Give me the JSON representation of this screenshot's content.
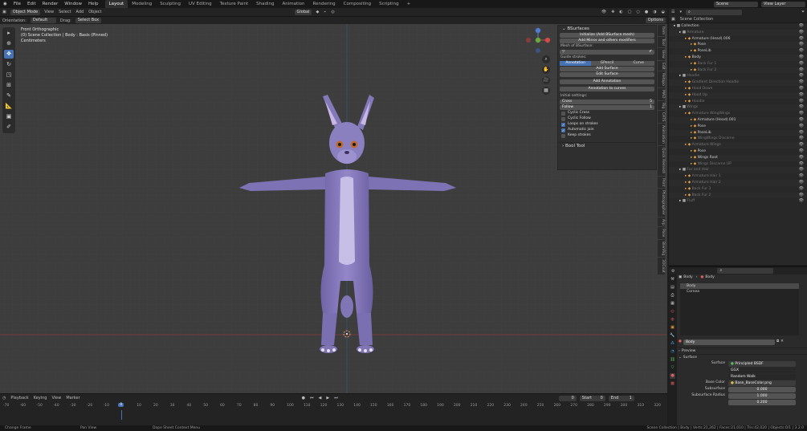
{
  "menu": [
    "File",
    "Edit",
    "Render",
    "Window",
    "Help"
  ],
  "workspaces": [
    "Layout",
    "Modeling",
    "Sculpting",
    "UV Editing",
    "Texture Paint",
    "Shading",
    "Animation",
    "Rendering",
    "Compositing",
    "Scripting",
    "+"
  ],
  "scene_label": "Scene",
  "view_layer_label": "View Layer",
  "header": {
    "mode": "Object Mode",
    "view": "View",
    "select": "Select",
    "add": "Add",
    "object": "Object",
    "orientation_global": "Global",
    "options": "Options"
  },
  "header2": {
    "orientation": "Orientation:",
    "orientation_val": "Default",
    "drag": "Drag:",
    "drag_val": "Select Box"
  },
  "viewport_info": [
    "Front Orthographic",
    "(0) Scene Collection | Body : Basis (Pinned)",
    "Centimeters"
  ],
  "npanel": {
    "title": "BSurfaces",
    "btn_init": "Initialize (Add BSurface mesh)",
    "btn_mirror": "Add Mirror and others modifiers",
    "mesh_label": "Mesh of BSurface:",
    "guide_label": "Guide strokes:",
    "tabs": [
      "Annotation",
      "GPencil",
      "Curve"
    ],
    "add_surface": "Add Surface",
    "edit_surface": "Edit Surface",
    "add_annotation": "Add Annotation",
    "annotation_to_curves": "Annotation to curves",
    "initial_settings": "Initial settings:",
    "cross_label": "Cross",
    "cross_val": "5",
    "follow_label": "Follow",
    "follow_val": "1",
    "checks": [
      {
        "label": "Cyclic Cross",
        "on": false
      },
      {
        "label": "Cyclic Follow",
        "on": false
      },
      {
        "label": "Loops on strokes",
        "on": true
      },
      {
        "label": "Automatic join",
        "on": true
      },
      {
        "label": "Keep strokes",
        "on": false
      }
    ],
    "bool_tool": "Bool Tool"
  },
  "side_tabs": [
    "Item",
    "Tool",
    "View",
    "Edit",
    "Retopo",
    "MAD",
    "Rig",
    "CATS",
    "Animation",
    "Quick Remesh",
    "Print",
    "Photographer",
    "Arp",
    "Pose",
    "BlenRig",
    "3DCoat"
  ],
  "timeline": {
    "menu": [
      "Playback",
      "Keying",
      "View",
      "Marker"
    ],
    "current": "0",
    "start_label": "Start",
    "start_val": "0",
    "end_label": "End",
    "end_val": "1",
    "ticks": [
      "-70",
      "-60",
      "-50",
      "-40",
      "-30",
      "-20",
      "-10",
      "0",
      "10",
      "20",
      "30",
      "40",
      "50",
      "60",
      "70",
      "80",
      "90",
      "100",
      "110",
      "120",
      "130",
      "140",
      "150",
      "160",
      "170",
      "180",
      "190",
      "200",
      "210",
      "220",
      "230",
      "240",
      "250",
      "260",
      "270",
      "280",
      "290",
      "300",
      "310",
      "320"
    ],
    "playhead": "0"
  },
  "status": {
    "left1": "Change Frame",
    "left2": "Pan View",
    "left3": "Dope Sheet Context Menu",
    "right": "Scene Collection | Body | Verts:21,262 | Faces:21,010 | Tris:42,020 | Objects:0/1 | 3.2.0"
  },
  "outliner": {
    "root": "Scene Collection",
    "rows": [
      {
        "t": "Collection",
        "d": 0
      },
      {
        "t": "Armature",
        "d": 1,
        "dim": true
      },
      {
        "t": "Armature (Head).006",
        "d": 2
      },
      {
        "t": "Pose",
        "d": 3
      },
      {
        "t": "PoseLib",
        "d": 3
      },
      {
        "t": "Body",
        "d": 2
      },
      {
        "t": "Back Fur 1",
        "d": 3,
        "dim": true
      },
      {
        "t": "Back Fur 2",
        "d": 3,
        "dim": true
      },
      {
        "t": "Hoodie",
        "d": 1,
        "dim": true
      },
      {
        "t": "Gradient Direction Hoodie",
        "d": 2,
        "dim": true
      },
      {
        "t": "Hood Down",
        "d": 2,
        "dim": true
      },
      {
        "t": "Hood Up",
        "d": 2,
        "dim": true
      },
      {
        "t": "Hoodie",
        "d": 2,
        "dim": true
      },
      {
        "t": "Wings",
        "d": 1,
        "dim": true
      },
      {
        "t": "Armature WingWings",
        "d": 2,
        "dim": true
      },
      {
        "t": "Armature (Head).001",
        "d": 3
      },
      {
        "t": "Pose",
        "d": 3
      },
      {
        "t": "PoseLib",
        "d": 3
      },
      {
        "t": "WingWings Discarne",
        "d": 3,
        "dim": true
      },
      {
        "t": "Armature Wings",
        "d": 2,
        "dim": true
      },
      {
        "t": "Pose",
        "d": 3
      },
      {
        "t": "Wings Root",
        "d": 3
      },
      {
        "t": "Wings Discarne UP",
        "d": 3,
        "dim": true
      },
      {
        "t": "Fur and Hair",
        "d": 1,
        "dim": true
      },
      {
        "t": "Armature Hair 1",
        "d": 2,
        "dim": true
      },
      {
        "t": "Armature Hair 2",
        "d": 2,
        "dim": true
      },
      {
        "t": "Back Fur 3",
        "d": 2,
        "dim": true
      },
      {
        "t": "Back Fur 2",
        "d": 2,
        "dim": true
      },
      {
        "t": "Fluff",
        "d": 1,
        "dim": true
      }
    ]
  },
  "props": {
    "breadcrumb1": "Body",
    "breadcrumb2": "Body",
    "slots": [
      "Body",
      "Cornea"
    ],
    "material_name": "Body",
    "preview": "Preview",
    "surface_section": "Surface",
    "surface_label": "Surface",
    "surface_val": "Principled BSDF",
    "dist_val": "GGX",
    "sss_method": "Random Walk",
    "base_color_label": "Base Color",
    "base_color_val": "Base_BaseColor.png",
    "subsurface_label": "Subsurface",
    "subsurface_val": "0.000",
    "subsurface_radius_label": "Subsurface Radius",
    "sr1": "1.000",
    "sr2": "0.200"
  },
  "colors": {
    "accent": "#4772b3",
    "character": "#8b7fc0",
    "grid": "#3d3d3d"
  }
}
